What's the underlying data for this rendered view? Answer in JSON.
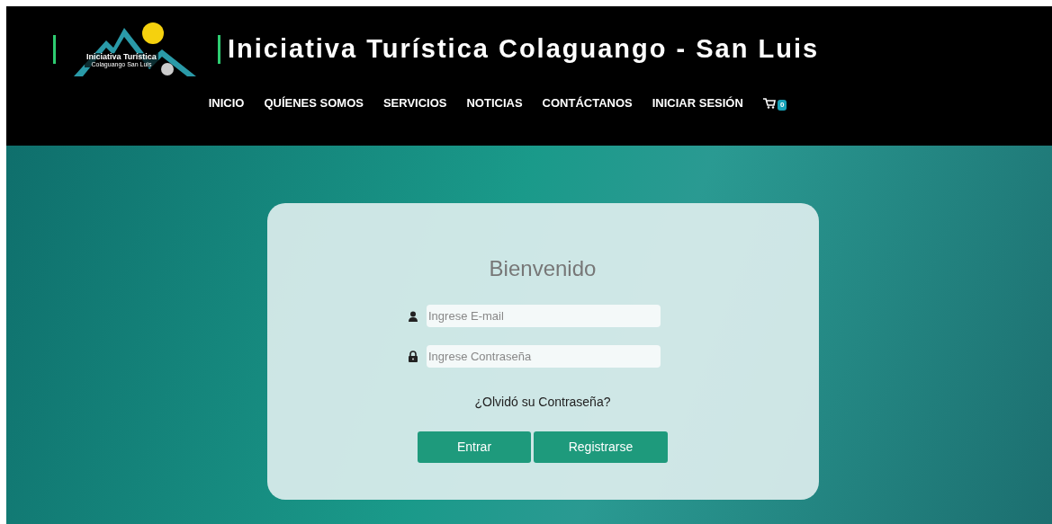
{
  "logo": {
    "line_1": "Iniciativa Turística",
    "line_2": "Colaguango San Luis"
  },
  "site_title": "Iniciativa Turística Colaguango - San Luis",
  "nav": [
    "INICIO",
    "QUÍENES SOMOS",
    "SERVICIOS",
    "NOTICIAS",
    "CONTÁCTANOS",
    "INICIAR SESIÓN"
  ],
  "cart": {
    "count": "0"
  },
  "login": {
    "title": "Bienvenido",
    "email": {
      "placeholder": "Ingrese E-mail"
    },
    "password": {
      "placeholder": "Ingrese Contraseña"
    },
    "forgot_link": "¿Olvidó su Contraseña?",
    "buttons": [
      "Entrar",
      "Registrarse"
    ]
  }
}
